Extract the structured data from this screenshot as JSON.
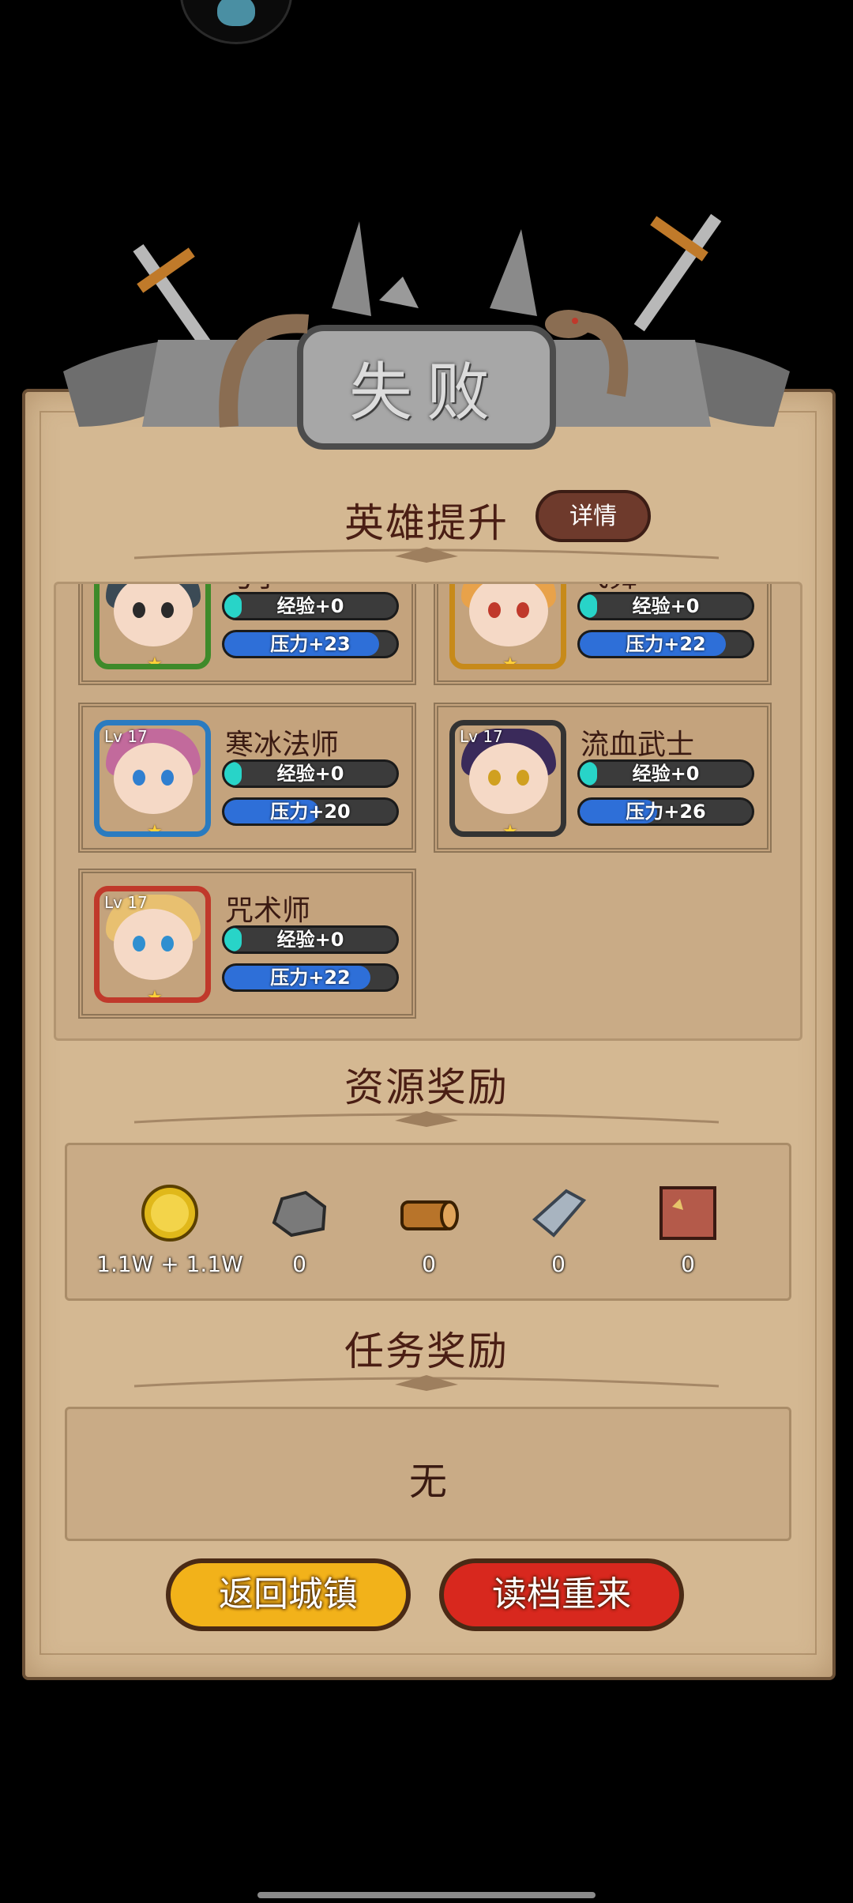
{
  "result": {
    "title": "失败"
  },
  "hero_section": {
    "title": "英雄提升",
    "detail_label": "详情",
    "heroes": [
      {
        "name": "弓手",
        "level": "",
        "exp": "经验+0",
        "pressure": "压力+23",
        "pressure_level": 0.9,
        "border": "#3e8a2a",
        "hair": "#3b4a55",
        "eye": "#2a2a2a"
      },
      {
        "name": "飞舞",
        "level": "",
        "exp": "经验+0",
        "pressure": "压力+22",
        "pressure_level": 0.85,
        "border": "#c78a1a",
        "hair": "#e8a24a",
        "eye": "#c0392b"
      },
      {
        "name": "寒冰法师",
        "level": "Lv 17",
        "exp": "经验+0",
        "pressure": "压力+20",
        "pressure_level": 0.55,
        "border": "#2a7bc0",
        "hair": "#c26a9c",
        "eye": "#2f7fd0"
      },
      {
        "name": "流血武士",
        "level": "Lv 17",
        "exp": "经验+0",
        "pressure": "压力+26",
        "pressure_level": 0.45,
        "border": "#333333",
        "hair": "#3a2a5a",
        "eye": "#d0a020"
      },
      {
        "name": "咒术师",
        "level": "Lv 17",
        "exp": "经验+0",
        "pressure": "压力+22",
        "pressure_level": 0.85,
        "border": "#c0392b",
        "hair": "#e8c070",
        "eye": "#2f8fd0"
      }
    ]
  },
  "resource_section": {
    "title": "资源奖励",
    "items": [
      {
        "icon": "gold-coin-icon",
        "value": "1.1W + 1.1W"
      },
      {
        "icon": "stone-icon",
        "value": "0"
      },
      {
        "icon": "wood-log-icon",
        "value": "0"
      },
      {
        "icon": "iron-ingot-icon",
        "value": "0"
      },
      {
        "icon": "leather-icon",
        "value": "0"
      }
    ]
  },
  "task_section": {
    "title": "任务奖励",
    "empty_text": "无"
  },
  "buttons": {
    "return_town": "返回城镇",
    "reload_save": "读档重来"
  },
  "colors": {
    "exp_fill": "#28d4c8",
    "pressure_fill": "#2e6fd8",
    "yellow_btn": "#f2b21a",
    "red_btn": "#d8281e"
  }
}
